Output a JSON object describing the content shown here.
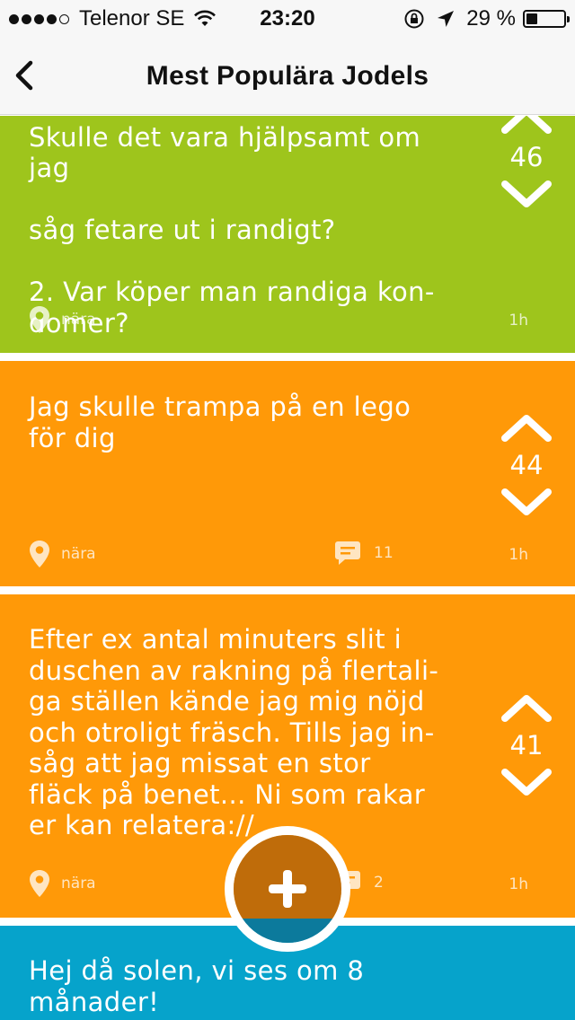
{
  "statusbar": {
    "carrier": "Telenor SE",
    "time": "23:20",
    "battery": "29 %",
    "signal_bars": 4,
    "battery_level": 0.29
  },
  "navbar": {
    "title": "Mest Populära Jodels",
    "back_icon": "chevron-left-icon"
  },
  "posts": [
    {
      "color": "#9ec51c",
      "text_partial_top": "Skulle det vara hjälpsamt om jag",
      "text": "såg fetare ut i randigt?\n\n2. Var köper man randiga kon-\ndomer?",
      "votes": "46",
      "location": "nära",
      "comments": "",
      "age": "1h"
    },
    {
      "color": "#ff9908",
      "text": "Jag skulle trampa på en lego\nför dig",
      "votes": "44",
      "location": "nära",
      "comments": "11",
      "age": "1h"
    },
    {
      "color": "#ff9908",
      "text": "Efter ex antal minuters slit i\nduschen av rakning på flertali-\nga ställen kände jag mig nöjd\noch otroligt fräsch. Tills jag in-\nsåg att jag missat en stor\nfläck på benet... Ni som rakar\ner kan relatera://",
      "votes": "41",
      "location": "nära",
      "comments": "2",
      "age": "1h"
    },
    {
      "color": "#06a3cb",
      "text": "Hej då solen, vi ses om 8\nmånader!"
    }
  ],
  "fab": {
    "icon": "plus-icon",
    "color_top": "#bf6c0a",
    "color_bottom": "#0c7a9c"
  }
}
